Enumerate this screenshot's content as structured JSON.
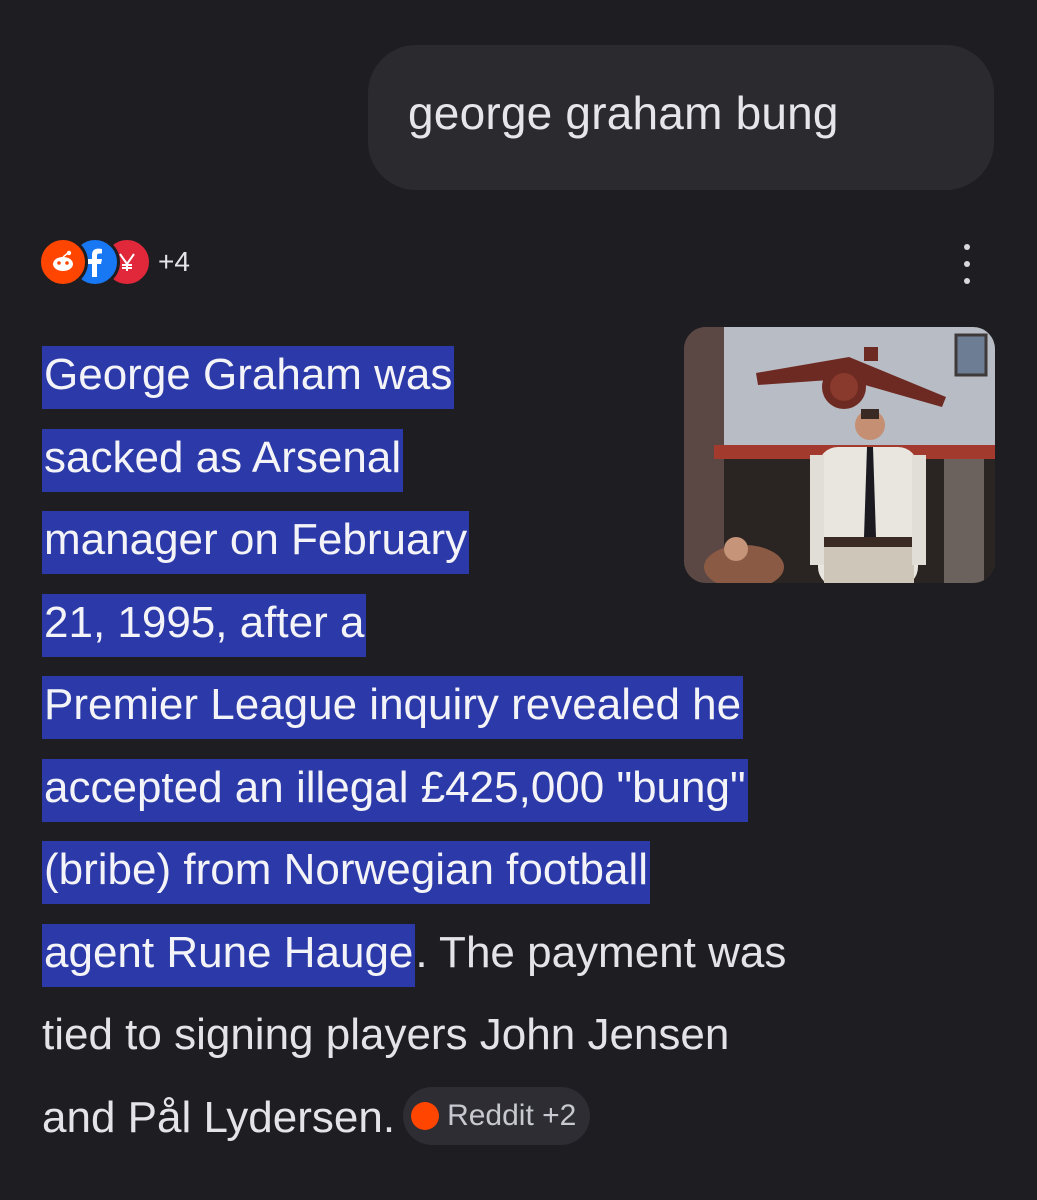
{
  "query": {
    "text": "george graham bung"
  },
  "sources": {
    "icons": [
      "reddit-icon",
      "facebook-icon",
      "ycombinator-icon"
    ],
    "more_count": "+4",
    "colors": {
      "reddit": "#ff4500",
      "facebook": "#1877f2",
      "ycombinator": "#e0283a"
    }
  },
  "answer": {
    "lines": [
      {
        "highlighted": "George Graham was",
        "plain": ""
      },
      {
        "highlighted": "sacked as Arsenal",
        "plain": ""
      },
      {
        "highlighted": "manager on February",
        "plain": ""
      },
      {
        "highlighted": "21, 1995, after a",
        "plain": ""
      },
      {
        "highlighted": "Premier League inquiry revealed he",
        "plain": ""
      },
      {
        "highlighted": "accepted an illegal £425,000 \"bung\"",
        "plain": ""
      },
      {
        "highlighted": "(bribe) from Norwegian football",
        "plain": ""
      },
      {
        "highlighted": "agent Rune Hauge",
        "plain": ". The payment was"
      },
      {
        "highlighted": "",
        "plain": "tied to signing players John Jensen"
      },
      {
        "highlighted": "",
        "plain": "and Pål Lydersen."
      }
    ],
    "highlight_color": "#2b3aa8"
  },
  "citation_chip": {
    "icon": "reddit-icon",
    "label": "Reddit +2"
  },
  "thumbnail": {
    "icon": "arsenal-cannon-photo"
  }
}
